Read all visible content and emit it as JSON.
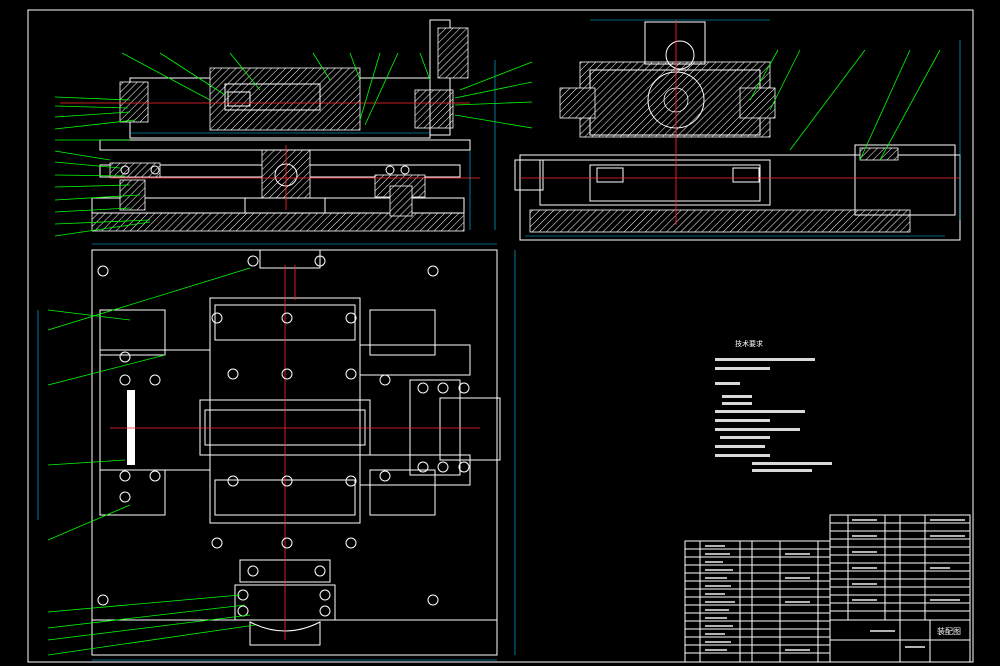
{
  "drawing": {
    "background_color": "#000000",
    "line_color": "#ffffff",
    "leader_color": "#00ff00",
    "dimension_color": "#00c8ff",
    "centerline_color": "#ff2a2a"
  },
  "notes": {
    "title": "技术要求"
  },
  "title_block": {
    "drawing_name": "装配图"
  }
}
